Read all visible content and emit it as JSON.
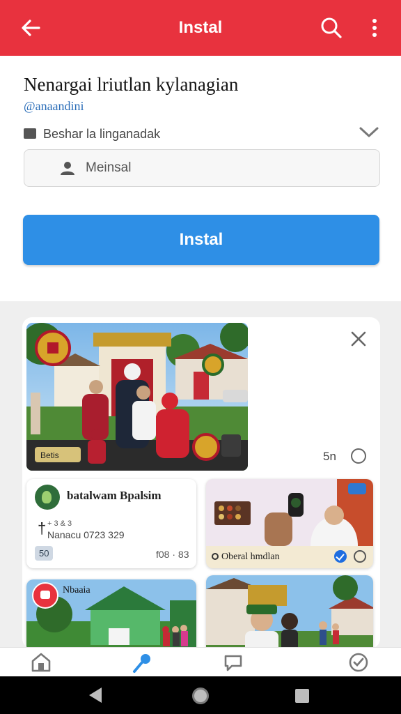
{
  "appbar": {
    "title": "Instal",
    "bg_color": "#e8323e",
    "icons": [
      "arrow-left-icon",
      "search-icon",
      "more-vertical-icon"
    ]
  },
  "form": {
    "heading": "Nenargai lriutlan kylanagian",
    "handle": "@anaandini",
    "option_label": "Beshar la linganadak",
    "input": {
      "value": "Meinsal",
      "placeholder": "Meinsal"
    },
    "install_button": "Instal",
    "accent_color": "#2e8fe6"
  },
  "feed": {
    "hero": {
      "count": "5n",
      "sign_text": "Betis"
    },
    "card1": {
      "name": "batalwam Bpalsim",
      "sub1": "+ 3 & 3",
      "sub2": "Nanacu 0723 329",
      "badge": "50",
      "meta": "f08 · 83"
    },
    "card2": {
      "label": "Oberal hmdlan"
    },
    "card3": {
      "label": "Nbaaia"
    }
  },
  "bottom_nav": [
    "home-icon",
    "microphone-icon",
    "chat-icon",
    "check-badge-icon"
  ],
  "system_nav": [
    "back-icon",
    "home-icon",
    "recents-icon"
  ]
}
